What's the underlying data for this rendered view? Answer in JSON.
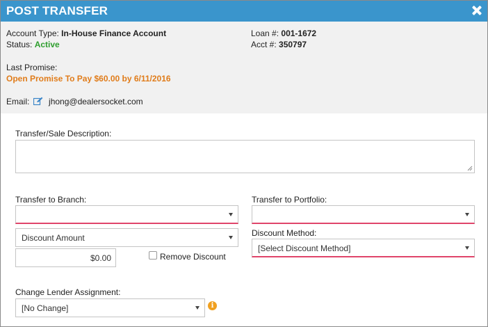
{
  "dialog": {
    "title": "POST TRANSFER"
  },
  "account": {
    "type_label": "Account Type:",
    "type_value": "In-House Finance Account",
    "status_label": "Status:",
    "status_value": "Active",
    "loan_label": "Loan #:",
    "loan_value": "001-1672",
    "acct_label": "Acct #:",
    "acct_value": "350797",
    "last_promise_label": "Last Promise:",
    "last_promise_value": "Open Promise To Pay $60.00 by 6/11/2016",
    "email_label": "Email:",
    "email_value": "jhong@dealersocket.com"
  },
  "form": {
    "description_label": "Transfer/Sale Description:",
    "description_value": "",
    "branch_label": "Transfer to Branch:",
    "branch_value": "",
    "portfolio_label": "Transfer to Portfolio:",
    "portfolio_value": "",
    "discount_type_value": "Discount Amount",
    "discount_amount_value": "$0.00",
    "remove_discount_label": "Remove Discount",
    "remove_discount_checked": false,
    "discount_method_label": "Discount Method:",
    "discount_method_value": "[Select Discount Method]",
    "lender_label": "Change Lender Assignment:",
    "lender_value": "[No Change]"
  },
  "icons": {
    "close": "close-icon",
    "edit": "edit-icon",
    "info": "info-icon",
    "caret": "chevron-down-icon"
  },
  "colors": {
    "titlebar": "#3a95cc",
    "active_status": "#2e9e2e",
    "promise": "#e07c1a",
    "required_underline": "#e0456a",
    "info_icon": "#f0a020"
  }
}
